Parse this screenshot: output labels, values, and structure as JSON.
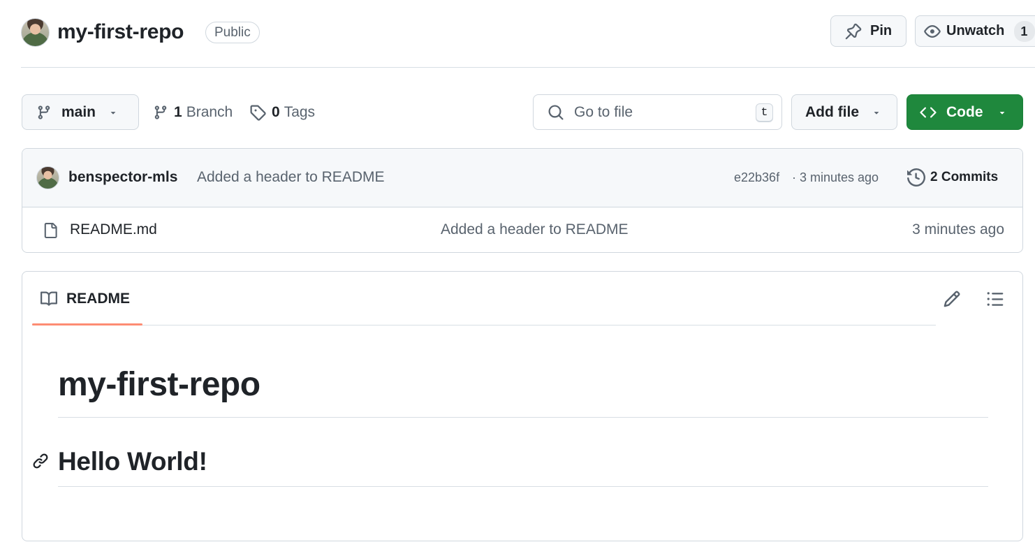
{
  "repo": {
    "name": "my-first-repo",
    "visibility": "Public"
  },
  "actions": {
    "pin_label": "Pin",
    "watch_label": "Unwatch",
    "watch_count": "1"
  },
  "toolbar": {
    "branch_name": "main",
    "branch_count": "1",
    "branch_label": "Branch",
    "tag_count": "0",
    "tag_label": "Tags",
    "search_placeholder": "Go to file",
    "search_shortcut": "t",
    "add_file_label": "Add file",
    "code_label": "Code"
  },
  "latest_commit": {
    "author": "benspector-mls",
    "message": "Added a header to README",
    "hash": "e22b36f",
    "separator": "·",
    "time": "3 minutes ago",
    "commit_count_label": "2 Commits"
  },
  "files": [
    {
      "name": "README.md",
      "message": "Added a header to README",
      "time": "3 minutes ago"
    }
  ],
  "readme": {
    "tab_label": "README",
    "heading1": "my-first-repo",
    "heading2": "Hello World!"
  },
  "colors": {
    "code_button": "#1f883d",
    "tab_accent": "#fd8c73",
    "muted_text": "#59636e",
    "border": "#d0d7de"
  },
  "icons": [
    "avatar",
    "pin-icon",
    "eye-icon",
    "git-branch-icon",
    "caret-down-icon",
    "tag-icon",
    "search-icon",
    "code-icon",
    "history-icon",
    "file-icon",
    "book-icon",
    "pencil-icon",
    "list-icon",
    "link-icon"
  ]
}
